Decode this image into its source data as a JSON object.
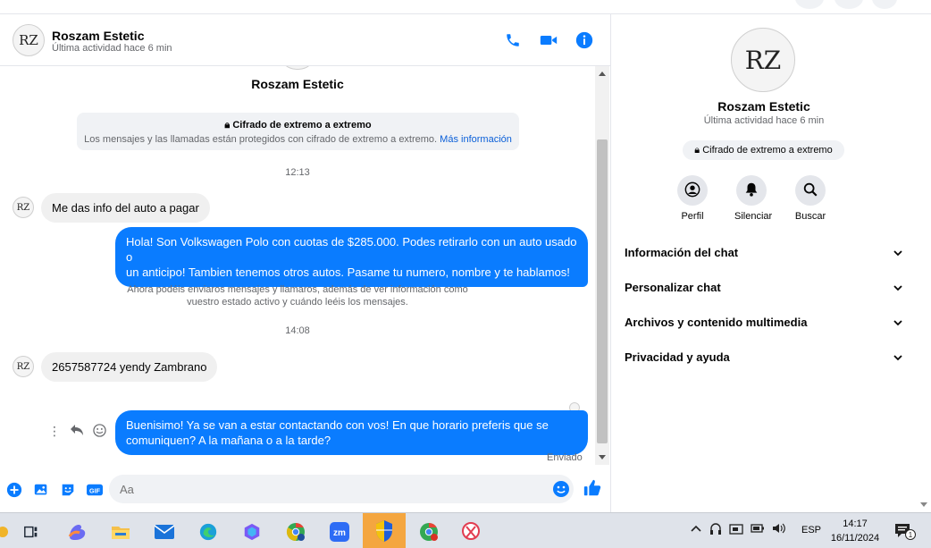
{
  "contact": {
    "name": "Roszam Estetic",
    "status": "Última actividad hace 6 min",
    "logo_text": "RZ"
  },
  "thread": {
    "contact_name": "Roszam Estetic",
    "e2e_title": "Cifrado de extremo a extremo",
    "e2e_body": "Los mensajes y las llamadas están protegidos con cifrado de extremo a extremo.",
    "e2e_link": "Más información",
    "time1": "12:13",
    "time2": "14:08",
    "system_note_1": "Ahora podéis enviaros mensajes y llamaros, además de ver información como",
    "system_note_2": "vuestro estado activo y cuándo leéis los mensajes.",
    "sent_status": "Enviado",
    "messages": [
      {
        "dir": "in",
        "lines": [
          "Me das info del auto a pagar"
        ]
      },
      {
        "dir": "out",
        "lines": [
          "Hola! Son Volkswagen Polo con cuotas de $285.000. Podes retirarlo con un auto usado o",
          "un anticipo! Tambien tenemos otros autos. Pasame tu numero, nombre  y te hablamos!"
        ]
      },
      {
        "dir": "in",
        "lines": [
          "2657587724 yendy Zambrano"
        ]
      },
      {
        "dir": "out",
        "lines": [
          "Buenisimo! Ya se van a estar contactando con vos! En que horario preferis que se",
          "comuniquen? A la mañana o a la tarde?"
        ]
      }
    ]
  },
  "composer": {
    "placeholder": "Aa",
    "icons": [
      "plus-icon",
      "image-icon",
      "sticker-icon",
      "gif-icon",
      "emoji-icon",
      "like-icon"
    ],
    "gif_label": "GIF"
  },
  "side": {
    "name": "Roszam Estetic",
    "status": "Última actividad hace 6 min",
    "e2e_badge": "Cifrado de extremo a extremo",
    "actions": [
      {
        "label": "Perfil",
        "icon": "profile-icon"
      },
      {
        "label": "Silenciar",
        "icon": "bell-icon"
      },
      {
        "label": "Buscar",
        "icon": "search-icon"
      }
    ],
    "sections": [
      "Información del chat",
      "Personalizar chat",
      "Archivos y contenido multimedia",
      "Privacidad y ayuda"
    ]
  },
  "taskbar": {
    "language": "ESP",
    "time": "14:17",
    "date": "16/11/2024",
    "notif_count": "1",
    "zoom_label": "zm",
    "apps": [
      "task-view",
      "copilot",
      "file-explorer",
      "mail",
      "edge",
      "copilot-alt",
      "chrome-profile",
      "zoom",
      "security-shield",
      "chrome-b",
      "snipping-tool"
    ]
  },
  "colors": {
    "accent": "#0a7cff",
    "bubble_in": "#f0f0f0",
    "taskbar_bg": "#dfe3ea",
    "taskbar_active": "#f4a640"
  }
}
